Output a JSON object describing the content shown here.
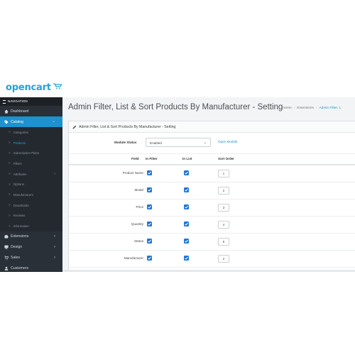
{
  "logo": {
    "text": "opencart"
  },
  "sidebar": {
    "header": "NAVIGATION",
    "items": [
      {
        "label": "Dashboard",
        "icon": "dashboard-icon",
        "active": false
      },
      {
        "label": "Catalog",
        "icon": "tag-icon",
        "active": true
      }
    ],
    "catalog_children": [
      {
        "label": "Categories",
        "current": false,
        "has_children": false
      },
      {
        "label": "Products",
        "current": true,
        "has_children": false
      },
      {
        "label": "Subscription Plans",
        "current": false,
        "has_children": false
      },
      {
        "label": "Filters",
        "current": false,
        "has_children": false
      },
      {
        "label": "Attributes",
        "current": false,
        "has_children": true
      },
      {
        "label": "Options",
        "current": false,
        "has_children": false
      },
      {
        "label": "Manufacturers",
        "current": false,
        "has_children": false
      },
      {
        "label": "Downloads",
        "current": false,
        "has_children": false
      },
      {
        "label": "Reviews",
        "current": false,
        "has_children": false
      },
      {
        "label": "Information",
        "current": false,
        "has_children": false
      }
    ],
    "lower_items": [
      {
        "label": "Extensions",
        "icon": "puzzle-icon"
      },
      {
        "label": "Design",
        "icon": "monitor-icon"
      },
      {
        "label": "Sales",
        "icon": "cart-icon"
      },
      {
        "label": "Customers",
        "icon": "user-icon"
      }
    ]
  },
  "header": {
    "title": "Admin Filter, List & Sort Products By Manufacturer - Setting",
    "breadcrumb": [
      "Home",
      "Extensions",
      "Admin Filter, L"
    ]
  },
  "panel": {
    "heading": "Admin Filter, List & Sort Products By Manufacturer - Setting",
    "module_status_label": "Module Status",
    "module_status_value": "Enabled",
    "open_module_link": "Open Module",
    "columns": [
      "Field",
      "In Filter",
      "In List",
      "Sort Order"
    ],
    "rows": [
      {
        "field": "Product Name",
        "in_filter": true,
        "in_list": true,
        "sort_order": "1"
      },
      {
        "field": "Model",
        "in_filter": true,
        "in_list": true,
        "sort_order": "2"
      },
      {
        "field": "Price",
        "in_filter": true,
        "in_list": true,
        "sort_order": "3"
      },
      {
        "field": "Quantity",
        "in_filter": true,
        "in_list": true,
        "sort_order": "4"
      },
      {
        "field": "Status",
        "in_filter": true,
        "in_list": true,
        "sort_order": "5"
      },
      {
        "field": "Manufacturer",
        "in_filter": true,
        "in_list": true,
        "sort_order": "2"
      }
    ]
  },
  "colors": {
    "accent": "#1e91cf",
    "sidebar_bg": "#2a3038",
    "checkbox": "#1e74d6",
    "logo": "#22a3dc"
  }
}
